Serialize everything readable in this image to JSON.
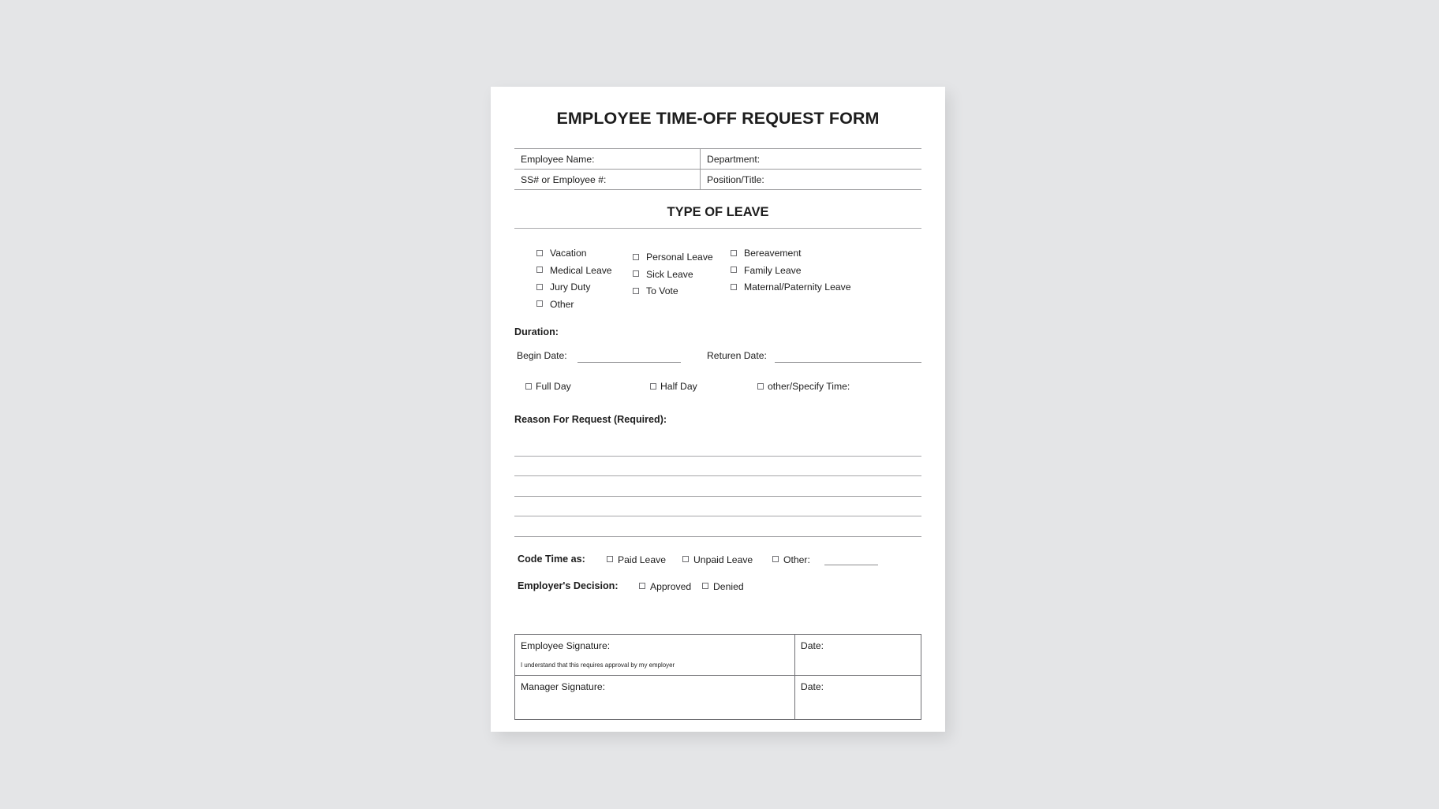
{
  "document": {
    "title": "EMPLOYEE TIME-OFF REQUEST FORM"
  },
  "info_table": {
    "rows": [
      {
        "left": "Employee Name:",
        "right": "Department:"
      },
      {
        "left": "SS# or Employee #:",
        "right": "Position/Title:"
      }
    ]
  },
  "type_of_leave": {
    "heading": "TYPE OF LEAVE",
    "column_1": [
      "Vacation",
      "Medical Leave",
      "Jury Duty",
      "Other"
    ],
    "column_2": [
      "Personal Leave",
      "Sick Leave",
      "To Vote"
    ],
    "column_3": [
      "Bereavement",
      "Family Leave",
      "Maternal/Paternity Leave"
    ]
  },
  "duration": {
    "heading": "Duration:",
    "begin_date_label": "Begin Date:",
    "return_date_label": "Returen Date:",
    "day_types": [
      "Full Day",
      "Half Day",
      "other/Specify Time:"
    ]
  },
  "reason": {
    "heading": "Reason For Request (Required):",
    "line_count": 5
  },
  "code_time": {
    "label": "Code Time as:",
    "options": [
      "Paid Leave",
      "Unpaid Leave",
      "Other:"
    ]
  },
  "employer_decision": {
    "label": "Employer's Decision:",
    "options": [
      "Approved",
      "Denied"
    ]
  },
  "signature_block": {
    "employee_signature_label": "Employee Signature:",
    "employee_fineprint": "I understand that this requires approval by my employer",
    "employee_date_label": "Date:",
    "manager_signature_label": "Manager Signature:",
    "manager_date_label": "Date:"
  },
  "colors": {
    "page_background": "#e4e5e7",
    "sheet": "#ffffff",
    "text": "#1d1d1d",
    "rule": "#9b9b9e",
    "table_border": "#6f6f73"
  }
}
